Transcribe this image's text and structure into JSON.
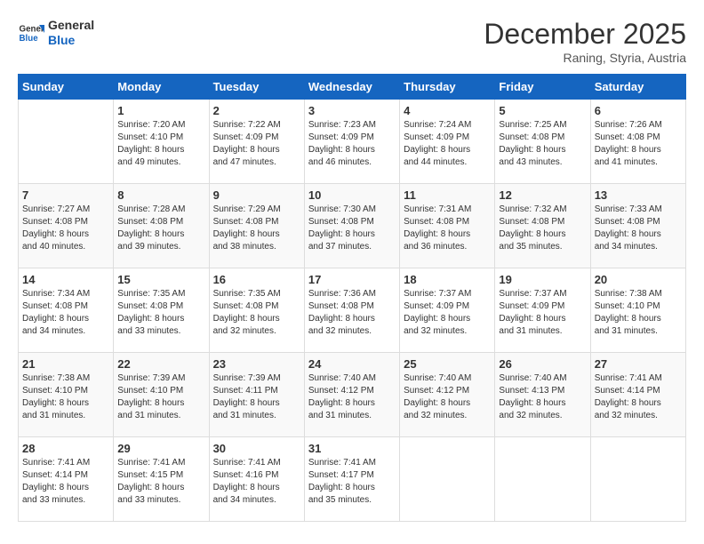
{
  "header": {
    "logo": {
      "line1": "General",
      "line2": "Blue"
    },
    "title": "December 2025",
    "subtitle": "Raning, Styria, Austria"
  },
  "days_of_week": [
    "Sunday",
    "Monday",
    "Tuesday",
    "Wednesday",
    "Thursday",
    "Friday",
    "Saturday"
  ],
  "weeks": [
    [
      {
        "day": "",
        "info": ""
      },
      {
        "day": "1",
        "info": "Sunrise: 7:20 AM\nSunset: 4:10 PM\nDaylight: 8 hours\nand 49 minutes."
      },
      {
        "day": "2",
        "info": "Sunrise: 7:22 AM\nSunset: 4:09 PM\nDaylight: 8 hours\nand 47 minutes."
      },
      {
        "day": "3",
        "info": "Sunrise: 7:23 AM\nSunset: 4:09 PM\nDaylight: 8 hours\nand 46 minutes."
      },
      {
        "day": "4",
        "info": "Sunrise: 7:24 AM\nSunset: 4:09 PM\nDaylight: 8 hours\nand 44 minutes."
      },
      {
        "day": "5",
        "info": "Sunrise: 7:25 AM\nSunset: 4:08 PM\nDaylight: 8 hours\nand 43 minutes."
      },
      {
        "day": "6",
        "info": "Sunrise: 7:26 AM\nSunset: 4:08 PM\nDaylight: 8 hours\nand 41 minutes."
      }
    ],
    [
      {
        "day": "7",
        "info": "Sunrise: 7:27 AM\nSunset: 4:08 PM\nDaylight: 8 hours\nand 40 minutes."
      },
      {
        "day": "8",
        "info": "Sunrise: 7:28 AM\nSunset: 4:08 PM\nDaylight: 8 hours\nand 39 minutes."
      },
      {
        "day": "9",
        "info": "Sunrise: 7:29 AM\nSunset: 4:08 PM\nDaylight: 8 hours\nand 38 minutes."
      },
      {
        "day": "10",
        "info": "Sunrise: 7:30 AM\nSunset: 4:08 PM\nDaylight: 8 hours\nand 37 minutes."
      },
      {
        "day": "11",
        "info": "Sunrise: 7:31 AM\nSunset: 4:08 PM\nDaylight: 8 hours\nand 36 minutes."
      },
      {
        "day": "12",
        "info": "Sunrise: 7:32 AM\nSunset: 4:08 PM\nDaylight: 8 hours\nand 35 minutes."
      },
      {
        "day": "13",
        "info": "Sunrise: 7:33 AM\nSunset: 4:08 PM\nDaylight: 8 hours\nand 34 minutes."
      }
    ],
    [
      {
        "day": "14",
        "info": "Sunrise: 7:34 AM\nSunset: 4:08 PM\nDaylight: 8 hours\nand 34 minutes."
      },
      {
        "day": "15",
        "info": "Sunrise: 7:35 AM\nSunset: 4:08 PM\nDaylight: 8 hours\nand 33 minutes."
      },
      {
        "day": "16",
        "info": "Sunrise: 7:35 AM\nSunset: 4:08 PM\nDaylight: 8 hours\nand 32 minutes."
      },
      {
        "day": "17",
        "info": "Sunrise: 7:36 AM\nSunset: 4:08 PM\nDaylight: 8 hours\nand 32 minutes."
      },
      {
        "day": "18",
        "info": "Sunrise: 7:37 AM\nSunset: 4:09 PM\nDaylight: 8 hours\nand 32 minutes."
      },
      {
        "day": "19",
        "info": "Sunrise: 7:37 AM\nSunset: 4:09 PM\nDaylight: 8 hours\nand 31 minutes."
      },
      {
        "day": "20",
        "info": "Sunrise: 7:38 AM\nSunset: 4:10 PM\nDaylight: 8 hours\nand 31 minutes."
      }
    ],
    [
      {
        "day": "21",
        "info": "Sunrise: 7:38 AM\nSunset: 4:10 PM\nDaylight: 8 hours\nand 31 minutes."
      },
      {
        "day": "22",
        "info": "Sunrise: 7:39 AM\nSunset: 4:10 PM\nDaylight: 8 hours\nand 31 minutes."
      },
      {
        "day": "23",
        "info": "Sunrise: 7:39 AM\nSunset: 4:11 PM\nDaylight: 8 hours\nand 31 minutes."
      },
      {
        "day": "24",
        "info": "Sunrise: 7:40 AM\nSunset: 4:12 PM\nDaylight: 8 hours\nand 31 minutes."
      },
      {
        "day": "25",
        "info": "Sunrise: 7:40 AM\nSunset: 4:12 PM\nDaylight: 8 hours\nand 32 minutes."
      },
      {
        "day": "26",
        "info": "Sunrise: 7:40 AM\nSunset: 4:13 PM\nDaylight: 8 hours\nand 32 minutes."
      },
      {
        "day": "27",
        "info": "Sunrise: 7:41 AM\nSunset: 4:14 PM\nDaylight: 8 hours\nand 32 minutes."
      }
    ],
    [
      {
        "day": "28",
        "info": "Sunrise: 7:41 AM\nSunset: 4:14 PM\nDaylight: 8 hours\nand 33 minutes."
      },
      {
        "day": "29",
        "info": "Sunrise: 7:41 AM\nSunset: 4:15 PM\nDaylight: 8 hours\nand 33 minutes."
      },
      {
        "day": "30",
        "info": "Sunrise: 7:41 AM\nSunset: 4:16 PM\nDaylight: 8 hours\nand 34 minutes."
      },
      {
        "day": "31",
        "info": "Sunrise: 7:41 AM\nSunset: 4:17 PM\nDaylight: 8 hours\nand 35 minutes."
      },
      {
        "day": "",
        "info": ""
      },
      {
        "day": "",
        "info": ""
      },
      {
        "day": "",
        "info": ""
      }
    ]
  ]
}
